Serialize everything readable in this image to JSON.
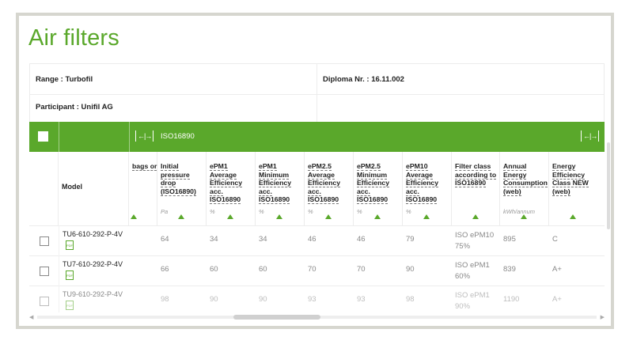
{
  "title": "Air filters",
  "info": {
    "range": "Range : Turbofil",
    "diploma": "Diploma Nr. : 16.11.002",
    "participant": "Participant : Unifil AG"
  },
  "band": {
    "standard": "ISO16890",
    "expand_glyph": "←|→"
  },
  "columns": [
    {
      "label": "bags or",
      "unit": ""
    },
    {
      "label": "Initial pressure drop (ISO16890)",
      "unit": "Pa"
    },
    {
      "label": "ePM1 Average Efficiency acc. ISO16890",
      "unit": "%"
    },
    {
      "label": "ePM1 Minimum Efficiency acc. ISO16890",
      "unit": "%"
    },
    {
      "label": "ePM2.5 Average Efficiency acc. ISO16890",
      "unit": "%"
    },
    {
      "label": "ePM2.5 Minimum Efficiency acc. ISO16890",
      "unit": "%"
    },
    {
      "label": "ePM10 Average Efficiency acc. ISO16890",
      "unit": "%"
    },
    {
      "label": "Filter class according to ISO16890",
      "unit": ""
    },
    {
      "label": "Annual Energy Consumption (web)",
      "unit": "kWh/annum"
    },
    {
      "label": "Energy Efficiency Class NEW (web)",
      "unit": ""
    }
  ],
  "model_header": "Model",
  "rows": [
    {
      "model": "TU6-610-292-P-4V",
      "pd": "64",
      "e1a": "34",
      "e1m": "34",
      "e25a": "46",
      "e25m": "46",
      "e10a": "79",
      "fc1": "ISO ePM10",
      "fc2": "75%",
      "aec": "895",
      "eec": "C"
    },
    {
      "model": "TU7-610-292-P-4V",
      "pd": "66",
      "e1a": "60",
      "e1m": "60",
      "e25a": "70",
      "e25m": "70",
      "e10a": "90",
      "fc1": "ISO ePM1",
      "fc2": "60%",
      "aec": "839",
      "eec": "A+"
    },
    {
      "model": "TU9-610-292-P-4V",
      "pd": "98",
      "e1a": "90",
      "e1m": "90",
      "e25a": "93",
      "e25m": "93",
      "e10a": "98",
      "fc1": "ISO ePM1",
      "fc2": "90%",
      "aec": "1190",
      "eec": "A+"
    }
  ],
  "pdf_icon_text": "PDF",
  "colors": {
    "accent": "#5aa82b",
    "frame": "#d6d6cf"
  }
}
